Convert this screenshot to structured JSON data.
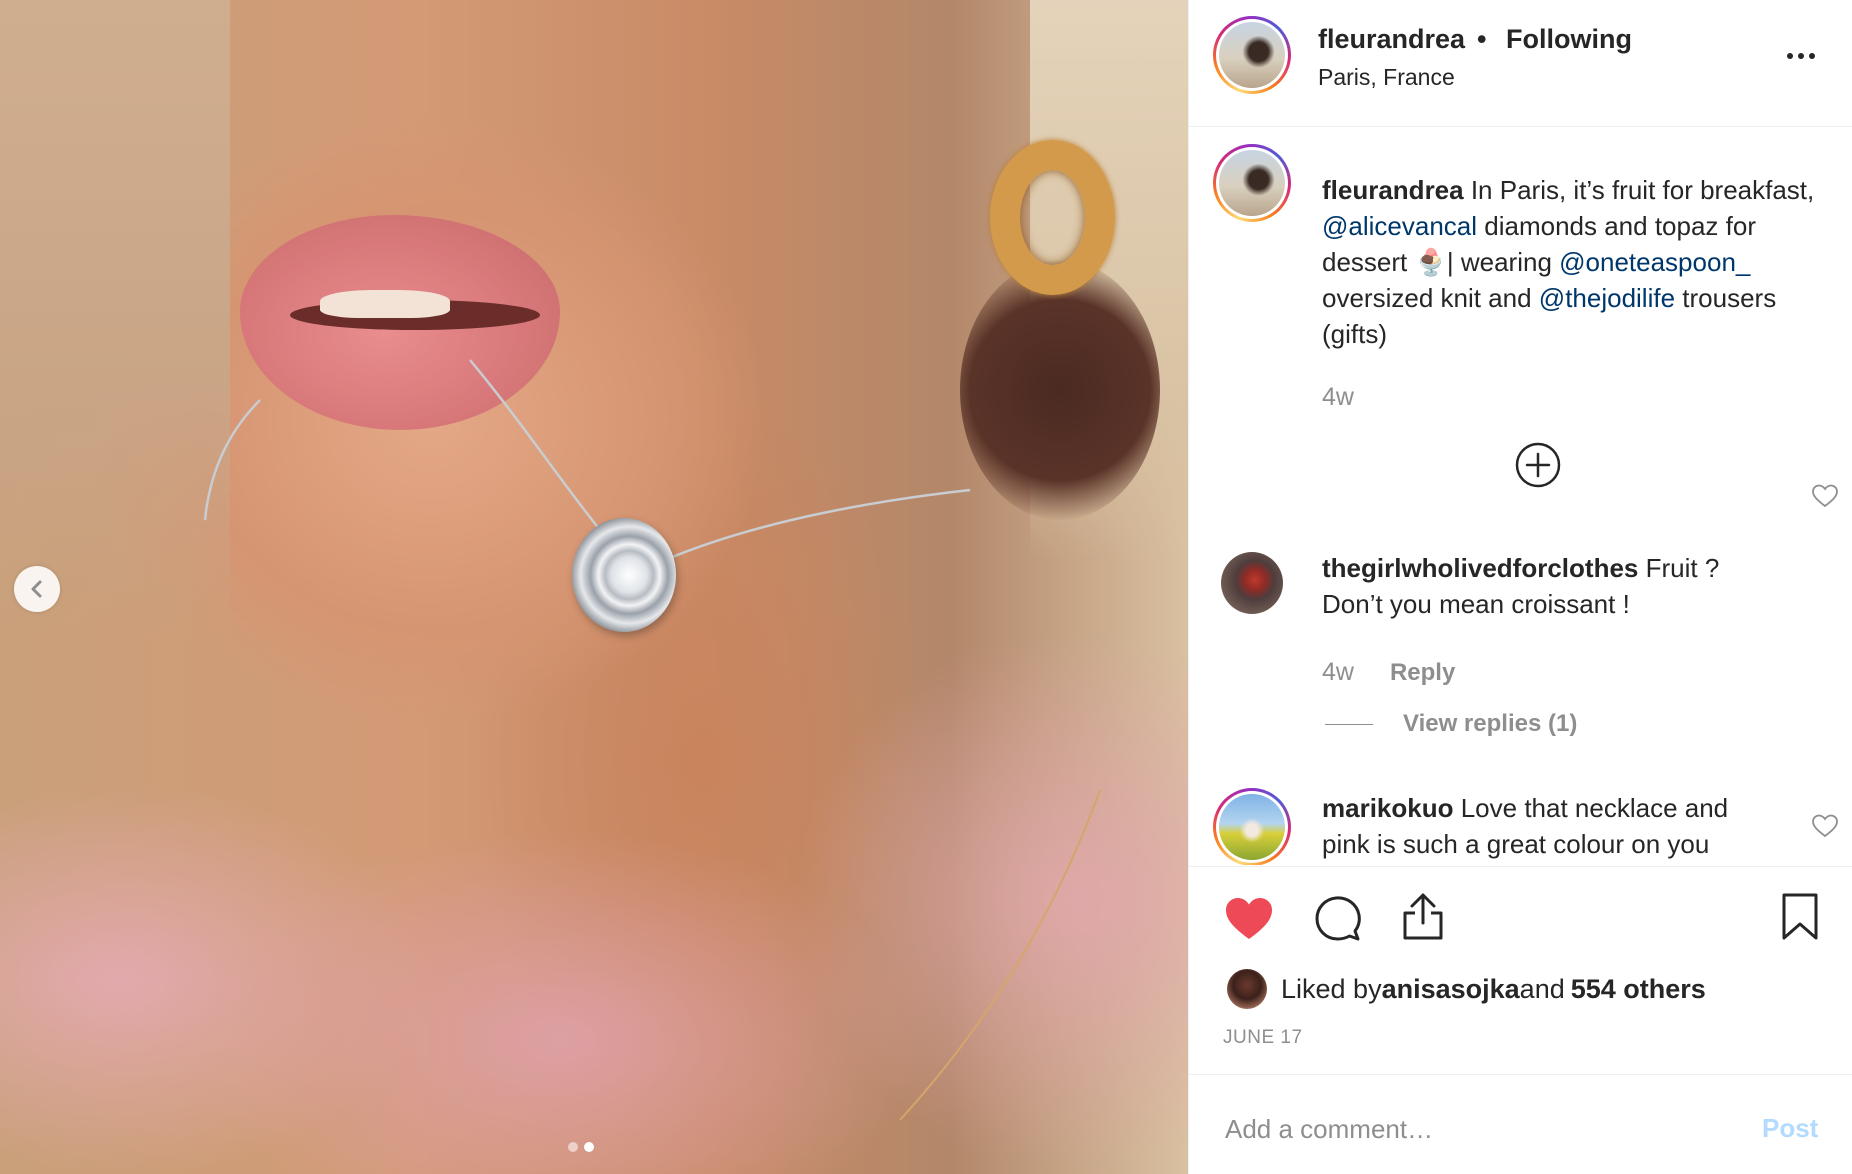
{
  "post": {
    "carousel": {
      "total_images": 2,
      "current_index": 2
    },
    "header": {
      "username": "fleurandrea",
      "separator": "•",
      "follow_status": "Following",
      "location": "Paris, France"
    },
    "caption": {
      "username": "fleurandrea",
      "text_1": " In Paris, it’s fruit for breakfast, ",
      "mention_1": "@alicevancal",
      "text_2": " diamonds and topaz for dessert ",
      "emoji": "🍨",
      "text_3": "| wearing ",
      "mention_2": "@oneteaspoon_",
      "text_4": " oversized knit and ",
      "mention_3": "@thejodilife",
      "text_5": " trousers (gifts)",
      "time": "4w"
    },
    "comments": [
      {
        "username": "thegirlwholivedforclothes",
        "text": " Fruit ? Don’t you mean croissant !",
        "time": "4w",
        "reply_label": "Reply",
        "view_replies_label": "View replies (1)"
      },
      {
        "username": "marikokuo",
        "text": " Love that necklace and pink is such a great colour on you"
      }
    ],
    "likes": {
      "prefix": "Liked by ",
      "user": "anisasojka",
      "middle": " and ",
      "others": "554 others"
    },
    "date": "JUNE 17",
    "comment_box": {
      "placeholder": "Add a comment…",
      "value": "",
      "post_label": "Post"
    },
    "colors": {
      "like_red": "#ed4956",
      "mention_blue": "#00376b",
      "post_disabled": "#b3dbff",
      "secondary_text": "#8e8e8e"
    },
    "icons": [
      "chevron-left-icon",
      "more-icon",
      "add-circle-icon",
      "heart-outline-icon",
      "heart-filled-icon",
      "comment-icon",
      "share-icon",
      "bookmark-icon"
    ]
  }
}
